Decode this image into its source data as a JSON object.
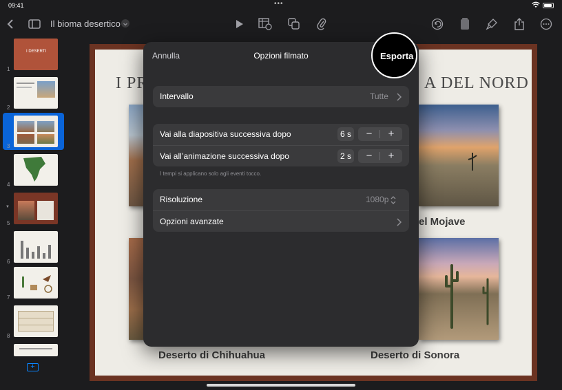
{
  "status_bar": {
    "time": "09:41",
    "dots": "•••"
  },
  "toolbar": {
    "document_title": "Il bioma desertico",
    "icons": [
      "back-chevron-icon",
      "sidebar-icon",
      "play-icon",
      "table-icon",
      "shapes-icon",
      "attachment-icon",
      "undo-icon",
      "document-icon",
      "brush-icon",
      "share-icon",
      "more-icon"
    ]
  },
  "sidebar": {
    "slides": [
      {
        "number": "1",
        "label": "I DESERTI"
      },
      {
        "number": "2"
      },
      {
        "number": "3"
      },
      {
        "number": "4"
      },
      {
        "number": "5"
      },
      {
        "number": "6"
      },
      {
        "number": "7"
      },
      {
        "number": "8"
      }
    ],
    "add_label": "+"
  },
  "slide": {
    "title_left": "I PR",
    "title_right": "A DEL NORD",
    "caption_top_right": "el Mojave",
    "caption_bottom_left": "Deserto di Chihuahua",
    "caption_bottom_right": "Deserto di Sonora"
  },
  "modal": {
    "cancel_label": "Annulla",
    "title": "Opzioni filmato",
    "export_label": "Esporta",
    "interval": {
      "label": "Intervallo",
      "value": "Tutte"
    },
    "next_slide": {
      "label": "Vai alla diapositiva successiva dopo",
      "value": "6 s"
    },
    "next_animation": {
      "label": "Vai all’animazione successiva dopo",
      "value": "2 s"
    },
    "footnote": "I tempi si applicano solo agli eventi tocco.",
    "resolution": {
      "label": "Risoluzione",
      "value": "1080p"
    },
    "advanced": {
      "label": "Opzioni avanzate"
    },
    "stepper_minus": "−",
    "stepper_plus": "+"
  },
  "colors": {
    "accent": "#0a84ff",
    "modal_bg": "#2c2c2e",
    "row_bg": "#3a3a3c",
    "slide_border": "#6b3322"
  }
}
